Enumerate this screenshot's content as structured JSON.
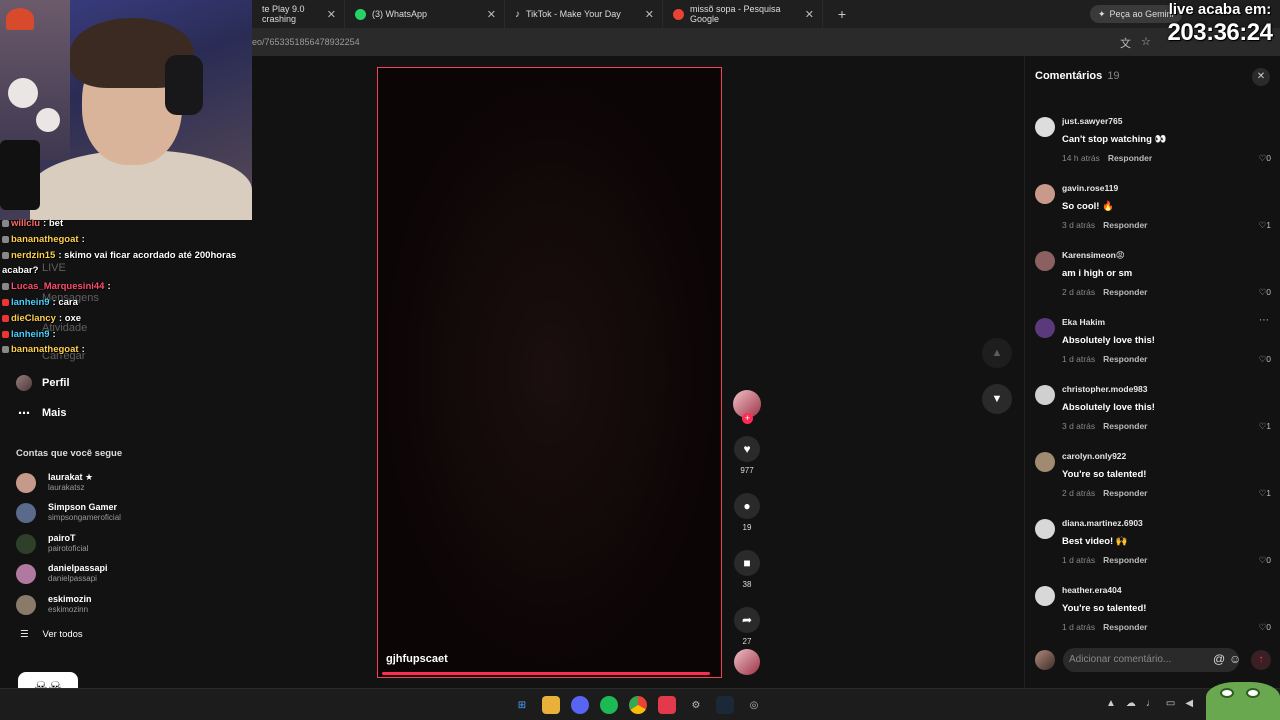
{
  "browser": {
    "tabs": [
      {
        "label": "te Play 9.0 crashing",
        "icon_color": "#4285f4"
      },
      {
        "label": "(3) WhatsApp",
        "icon_color": "#25d366"
      },
      {
        "label": "TikTok - Make Your Day",
        "icon_color": "#ffffff"
      },
      {
        "label": "missõ sopa - Pesquisa Google",
        "icon_color": "#ea4335"
      }
    ],
    "new_tab": "+",
    "gemini_label": "Peça ao Gemini",
    "url": "eo/7653351856478932254"
  },
  "stream_overlay": {
    "timer_label": "live acaba em:",
    "timer_value": "203:36:24"
  },
  "chat": [
    {
      "user": "willclu",
      "text": "bet",
      "color": "#ff6b6b"
    },
    {
      "user": "bananathegoat",
      "text": "",
      "color": "#ffd24d"
    },
    {
      "user": "nerdzin15",
      "text": "skimo vai ficar acordado até 200horas acabar?",
      "color": "#ffd24d"
    },
    {
      "user": "Lucas_Marquesini44",
      "text": "",
      "color": "#ff4d6d"
    },
    {
      "user": "lanhein9",
      "text": "cara",
      "color": "#4dd2ff"
    },
    {
      "user": "dieClancy",
      "text": "oxe",
      "color": "#ffd24d"
    },
    {
      "user": "lanhein9",
      "text": "",
      "color": "#4dd2ff"
    },
    {
      "user": "bananathegoat",
      "text": "",
      "color": "#ffd24d"
    }
  ],
  "sidebar": {
    "ghost_items": [
      "LIVE",
      "Mensagens",
      "Atividade",
      "Carregar"
    ],
    "nav": [
      {
        "label": "Perfil",
        "icon": "profile-avatar"
      },
      {
        "label": "Mais",
        "icon": "more-dots-icon"
      }
    ],
    "following_title": "Contas que você segue",
    "following": [
      {
        "name": "laurakat ★",
        "handle": "laurakatsz",
        "color": "#c69a8a"
      },
      {
        "name": "Simpson Gamer",
        "handle": "simpsongameroficial",
        "color": "#5a6a8a"
      },
      {
        "name": "pairoT",
        "handle": "pairotoficial",
        "color": "#2f3f2a"
      },
      {
        "name": "danielpassapi",
        "handle": "danielpassapi",
        "color": "#b07aa0"
      },
      {
        "name": "eskimozin",
        "handle": "eskimozinn",
        "color": "#8a7a6a"
      }
    ],
    "see_all": "Ver todos"
  },
  "video": {
    "author": "gjhfupscaet",
    "progress": 0.98,
    "actions": [
      {
        "name": "like",
        "icon": "♥",
        "count": "977"
      },
      {
        "name": "comment",
        "icon": "●",
        "count": "19"
      },
      {
        "name": "save",
        "icon": "■",
        "count": "38"
      },
      {
        "name": "share",
        "icon": "➦",
        "count": "27"
      }
    ]
  },
  "comments": {
    "title": "Comentários",
    "count": "19",
    "reply_label": "Responder",
    "items": [
      {
        "user": "just.sawyer765",
        "text": "Can't stop watching 👀",
        "time": "14 h atrás",
        "likes": "0",
        "color": "#dddddd"
      },
      {
        "user": "gavin.rose119",
        "text": "So cool! 🔥",
        "time": "3 d atrás",
        "likes": "1",
        "color": "#c99a8a"
      },
      {
        "user": "Karensimeon😡",
        "text": "am i high or sm",
        "time": "2 d atrás",
        "likes": "0",
        "color": "#8a6060"
      },
      {
        "user": "Eka Hakim",
        "text": "Absolutely love this!",
        "time": "1 d atrás",
        "likes": "0",
        "color": "#5a3a7a"
      },
      {
        "user": "christopher.mode983",
        "text": "Absolutely love this!",
        "time": "3 d atrás",
        "likes": "1",
        "color": "#d0d0d0"
      },
      {
        "user": "carolyn.only922",
        "text": "You're so talented!",
        "time": "2 d atrás",
        "likes": "1",
        "color": "#a08a70"
      },
      {
        "user": "diana.martinez.6903",
        "text": "Best video! 🙌",
        "time": "1 d atrás",
        "likes": "0",
        "color": "#d8d8d8"
      },
      {
        "user": "heather.era404",
        "text": "You're so talented!",
        "time": "1 d atrás",
        "likes": "0",
        "color": "#d8d8d8"
      }
    ],
    "input_placeholder": "Adicionar comentário..."
  },
  "colors": {
    "accent": "#fe2c55",
    "background": "#121212"
  }
}
